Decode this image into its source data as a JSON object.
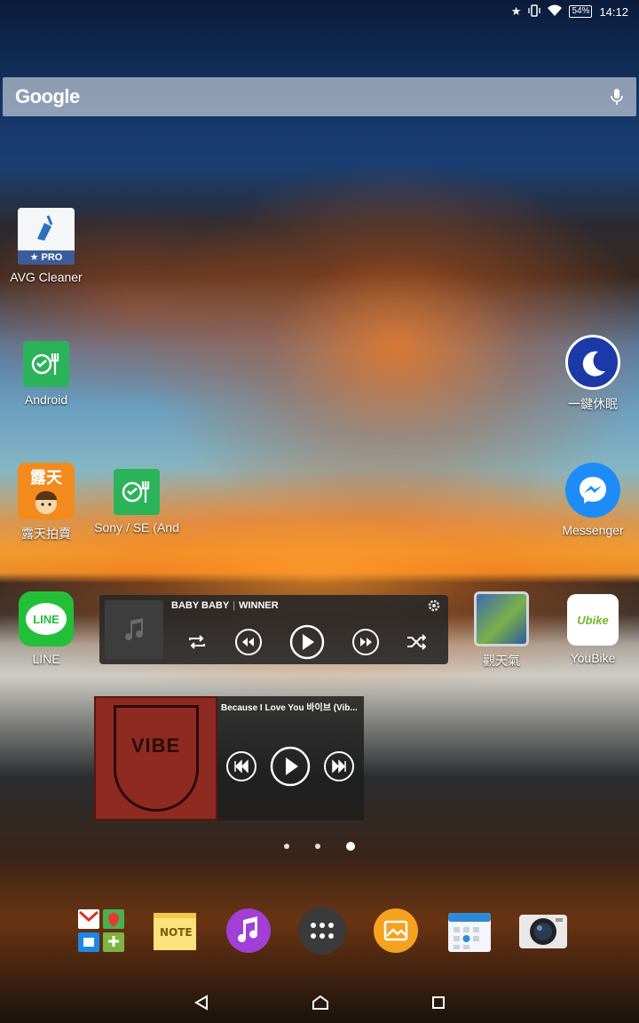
{
  "status_bar": {
    "battery_percent": "54%",
    "time": "14:12",
    "icons": [
      "star-icon",
      "vibrate-icon",
      "wifi-icon",
      "battery-icon"
    ]
  },
  "search": {
    "logo": "Google",
    "icon": "mic-icon"
  },
  "apps": {
    "avg_cleaner": {
      "label": "AVG Cleaner",
      "badge": "★ PRO"
    },
    "android": {
      "label": "Android"
    },
    "sleep": {
      "label": "一鍵休眠"
    },
    "lutian": {
      "label": "露天拍賣",
      "icon_text": "露天"
    },
    "sony_se": {
      "label": "Sony / SE (And"
    },
    "messenger": {
      "label": "Messenger"
    },
    "line": {
      "label": "LINE",
      "icon_text": "LINE"
    },
    "weather": {
      "label": "觀天氣"
    },
    "youbike": {
      "label": "YouBike",
      "icon_text": "Ubike"
    }
  },
  "music_widget_1": {
    "song": "BABY BABY",
    "artist": "WINNER"
  },
  "music_widget_2": {
    "title": "Because I Love You 바이브 (Vib...",
    "art_text": "VIBE"
  },
  "page_indicator": {
    "pages": 3,
    "current": 3
  },
  "dock": [
    "google-apps-folder-icon",
    "note-icon",
    "music-icon",
    "app-drawer-icon",
    "album-icon",
    "calendar-icon",
    "camera-icon"
  ],
  "navigation": [
    "back-icon",
    "home-icon",
    "recents-icon"
  ]
}
